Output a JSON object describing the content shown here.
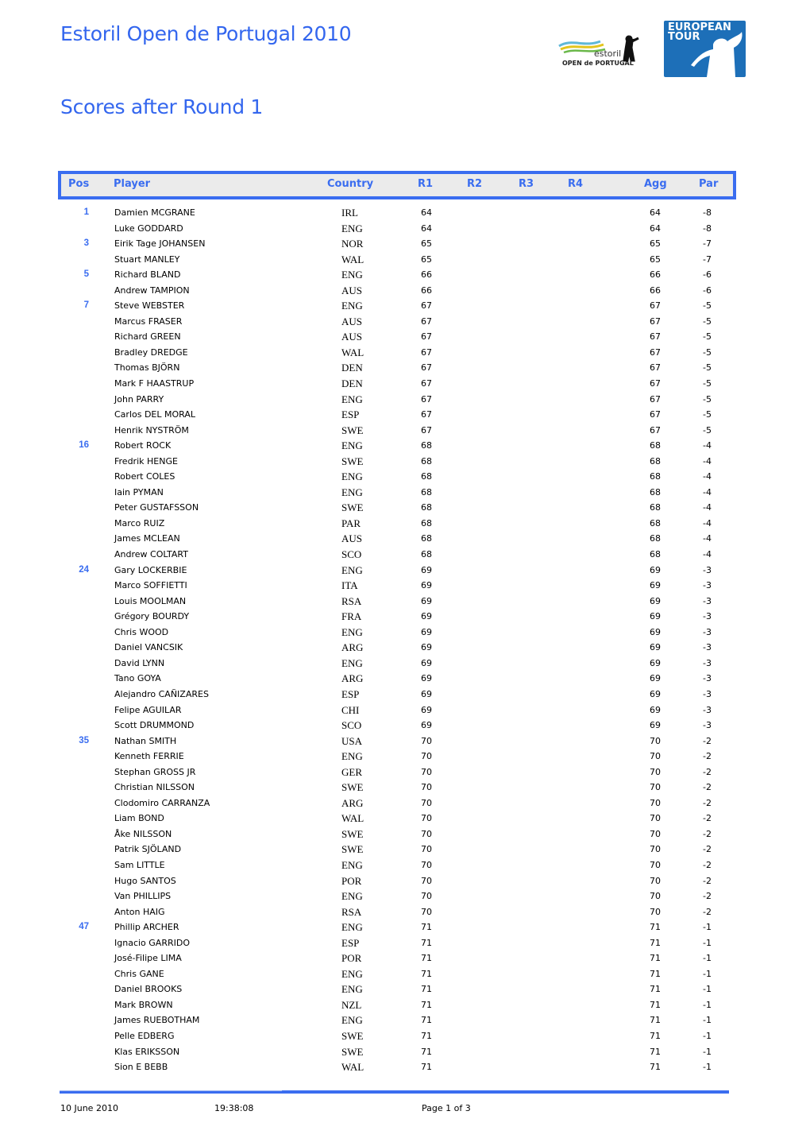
{
  "header": {
    "title": "Estoril Open de Portugal 2010",
    "subtitle": "Scores after Round 1",
    "logos": {
      "tournament": {
        "icon": "estoril-open-logo",
        "line1": "estoril",
        "line2": "OPEN de PORTUGAL"
      },
      "tour": {
        "icon": "european-tour-logo",
        "line1": "EUROPEAN",
        "line2": "TOUR"
      }
    }
  },
  "colors": {
    "accent": "#3a6df0",
    "header_bg": "#ebebeb",
    "tour_blue": "#1d6fb8"
  },
  "table": {
    "columns": [
      "Pos",
      "Player",
      "Country",
      "R1",
      "R2",
      "R3",
      "R4",
      "Agg",
      "Par"
    ],
    "rows": [
      {
        "pos": "1",
        "player": "Damien MCGRANE",
        "country": "IRL",
        "r1": "64",
        "agg": "64",
        "par": "-8"
      },
      {
        "pos": "",
        "player": "Luke GODDARD",
        "country": "ENG",
        "r1": "64",
        "agg": "64",
        "par": "-8"
      },
      {
        "pos": "3",
        "player": "Eirik Tage JOHANSEN",
        "country": "NOR",
        "r1": "65",
        "agg": "65",
        "par": "-7"
      },
      {
        "pos": "",
        "player": "Stuart MANLEY",
        "country": "WAL",
        "r1": "65",
        "agg": "65",
        "par": "-7"
      },
      {
        "pos": "5",
        "player": "Richard BLAND",
        "country": "ENG",
        "r1": "66",
        "agg": "66",
        "par": "-6"
      },
      {
        "pos": "",
        "player": "Andrew TAMPION",
        "country": "AUS",
        "r1": "66",
        "agg": "66",
        "par": "-6"
      },
      {
        "pos": "7",
        "player": "Steve WEBSTER",
        "country": "ENG",
        "r1": "67",
        "agg": "67",
        "par": "-5"
      },
      {
        "pos": "",
        "player": "Marcus FRASER",
        "country": "AUS",
        "r1": "67",
        "agg": "67",
        "par": "-5"
      },
      {
        "pos": "",
        "player": "Richard GREEN",
        "country": "AUS",
        "r1": "67",
        "agg": "67",
        "par": "-5"
      },
      {
        "pos": "",
        "player": "Bradley DREDGE",
        "country": "WAL",
        "r1": "67",
        "agg": "67",
        "par": "-5"
      },
      {
        "pos": "",
        "player": "Thomas BJÖRN",
        "country": "DEN",
        "r1": "67",
        "agg": "67",
        "par": "-5"
      },
      {
        "pos": "",
        "player": "Mark F HAASTRUP",
        "country": "DEN",
        "r1": "67",
        "agg": "67",
        "par": "-5"
      },
      {
        "pos": "",
        "player": "John PARRY",
        "country": "ENG",
        "r1": "67",
        "agg": "67",
        "par": "-5"
      },
      {
        "pos": "",
        "player": "Carlos DEL MORAL",
        "country": "ESP",
        "r1": "67",
        "agg": "67",
        "par": "-5"
      },
      {
        "pos": "",
        "player": "Henrik NYSTRÖM",
        "country": "SWE",
        "r1": "67",
        "agg": "67",
        "par": "-5"
      },
      {
        "pos": "16",
        "player": "Robert ROCK",
        "country": "ENG",
        "r1": "68",
        "agg": "68",
        "par": "-4"
      },
      {
        "pos": "",
        "player": "Fredrik HENGE",
        "country": "SWE",
        "r1": "68",
        "agg": "68",
        "par": "-4"
      },
      {
        "pos": "",
        "player": "Robert COLES",
        "country": "ENG",
        "r1": "68",
        "agg": "68",
        "par": "-4"
      },
      {
        "pos": "",
        "player": "Iain PYMAN",
        "country": "ENG",
        "r1": "68",
        "agg": "68",
        "par": "-4"
      },
      {
        "pos": "",
        "player": "Peter GUSTAFSSON",
        "country": "SWE",
        "r1": "68",
        "agg": "68",
        "par": "-4"
      },
      {
        "pos": "",
        "player": "Marco RUIZ",
        "country": "PAR",
        "r1": "68",
        "agg": "68",
        "par": "-4"
      },
      {
        "pos": "",
        "player": "James MCLEAN",
        "country": "AUS",
        "r1": "68",
        "agg": "68",
        "par": "-4"
      },
      {
        "pos": "",
        "player": "Andrew COLTART",
        "country": "SCO",
        "r1": "68",
        "agg": "68",
        "par": "-4"
      },
      {
        "pos": "24",
        "player": "Gary LOCKERBIE",
        "country": "ENG",
        "r1": "69",
        "agg": "69",
        "par": "-3"
      },
      {
        "pos": "",
        "player": "Marco SOFFIETTI",
        "country": "ITA",
        "r1": "69",
        "agg": "69",
        "par": "-3"
      },
      {
        "pos": "",
        "player": "Louis MOOLMAN",
        "country": "RSA",
        "r1": "69",
        "agg": "69",
        "par": "-3"
      },
      {
        "pos": "",
        "player": "Grégory BOURDY",
        "country": "FRA",
        "r1": "69",
        "agg": "69",
        "par": "-3"
      },
      {
        "pos": "",
        "player": "Chris WOOD",
        "country": "ENG",
        "r1": "69",
        "agg": "69",
        "par": "-3"
      },
      {
        "pos": "",
        "player": "Daniel VANCSIK",
        "country": "ARG",
        "r1": "69",
        "agg": "69",
        "par": "-3"
      },
      {
        "pos": "",
        "player": "David LYNN",
        "country": "ENG",
        "r1": "69",
        "agg": "69",
        "par": "-3"
      },
      {
        "pos": "",
        "player": "Tano GOYA",
        "country": "ARG",
        "r1": "69",
        "agg": "69",
        "par": "-3"
      },
      {
        "pos": "",
        "player": "Alejandro CAÑIZARES",
        "country": "ESP",
        "r1": "69",
        "agg": "69",
        "par": "-3"
      },
      {
        "pos": "",
        "player": "Felipe AGUILAR",
        "country": "CHI",
        "r1": "69",
        "agg": "69",
        "par": "-3"
      },
      {
        "pos": "",
        "player": "Scott DRUMMOND",
        "country": "SCO",
        "r1": "69",
        "agg": "69",
        "par": "-3"
      },
      {
        "pos": "35",
        "player": "Nathan SMITH",
        "country": "USA",
        "r1": "70",
        "agg": "70",
        "par": "-2"
      },
      {
        "pos": "",
        "player": "Kenneth FERRIE",
        "country": "ENG",
        "r1": "70",
        "agg": "70",
        "par": "-2"
      },
      {
        "pos": "",
        "player": "Stephan GROSS JR",
        "country": "GER",
        "r1": "70",
        "agg": "70",
        "par": "-2"
      },
      {
        "pos": "",
        "player": "Christian NILSSON",
        "country": "SWE",
        "r1": "70",
        "agg": "70",
        "par": "-2"
      },
      {
        "pos": "",
        "player": "Clodomiro CARRANZA",
        "country": "ARG",
        "r1": "70",
        "agg": "70",
        "par": "-2"
      },
      {
        "pos": "",
        "player": "Liam BOND",
        "country": "WAL",
        "r1": "70",
        "agg": "70",
        "par": "-2"
      },
      {
        "pos": "",
        "player": "Åke NILSSON",
        "country": "SWE",
        "r1": "70",
        "agg": "70",
        "par": "-2"
      },
      {
        "pos": "",
        "player": "Patrik SJÖLAND",
        "country": "SWE",
        "r1": "70",
        "agg": "70",
        "par": "-2"
      },
      {
        "pos": "",
        "player": "Sam LITTLE",
        "country": "ENG",
        "r1": "70",
        "agg": "70",
        "par": "-2"
      },
      {
        "pos": "",
        "player": "Hugo SANTOS",
        "country": "POR",
        "r1": "70",
        "agg": "70",
        "par": "-2"
      },
      {
        "pos": "",
        "player": "Van PHILLIPS",
        "country": "ENG",
        "r1": "70",
        "agg": "70",
        "par": "-2"
      },
      {
        "pos": "",
        "player": "Anton HAIG",
        "country": "RSA",
        "r1": "70",
        "agg": "70",
        "par": "-2"
      },
      {
        "pos": "47",
        "player": "Phillip ARCHER",
        "country": "ENG",
        "r1": "71",
        "agg": "71",
        "par": "-1"
      },
      {
        "pos": "",
        "player": "Ignacio GARRIDO",
        "country": "ESP",
        "r1": "71",
        "agg": "71",
        "par": "-1"
      },
      {
        "pos": "",
        "player": "José-Filipe LIMA",
        "country": "POR",
        "r1": "71",
        "agg": "71",
        "par": "-1"
      },
      {
        "pos": "",
        "player": "Chris GANE",
        "country": "ENG",
        "r1": "71",
        "agg": "71",
        "par": "-1"
      },
      {
        "pos": "",
        "player": "Daniel BROOKS",
        "country": "ENG",
        "r1": "71",
        "agg": "71",
        "par": "-1"
      },
      {
        "pos": "",
        "player": "Mark BROWN",
        "country": "NZL",
        "r1": "71",
        "agg": "71",
        "par": "-1"
      },
      {
        "pos": "",
        "player": "James RUEBOTHAM",
        "country": "ENG",
        "r1": "71",
        "agg": "71",
        "par": "-1"
      },
      {
        "pos": "",
        "player": "Pelle EDBERG",
        "country": "SWE",
        "r1": "71",
        "agg": "71",
        "par": "-1"
      },
      {
        "pos": "",
        "player": "Klas ERIKSSON",
        "country": "SWE",
        "r1": "71",
        "agg": "71",
        "par": "-1"
      },
      {
        "pos": "",
        "player": "Sion E BEBB",
        "country": "WAL",
        "r1": "71",
        "agg": "71",
        "par": "-1"
      }
    ]
  },
  "footer": {
    "date": "10 June 2010",
    "time": "19:38:08",
    "page": "Page 1 of 3"
  }
}
